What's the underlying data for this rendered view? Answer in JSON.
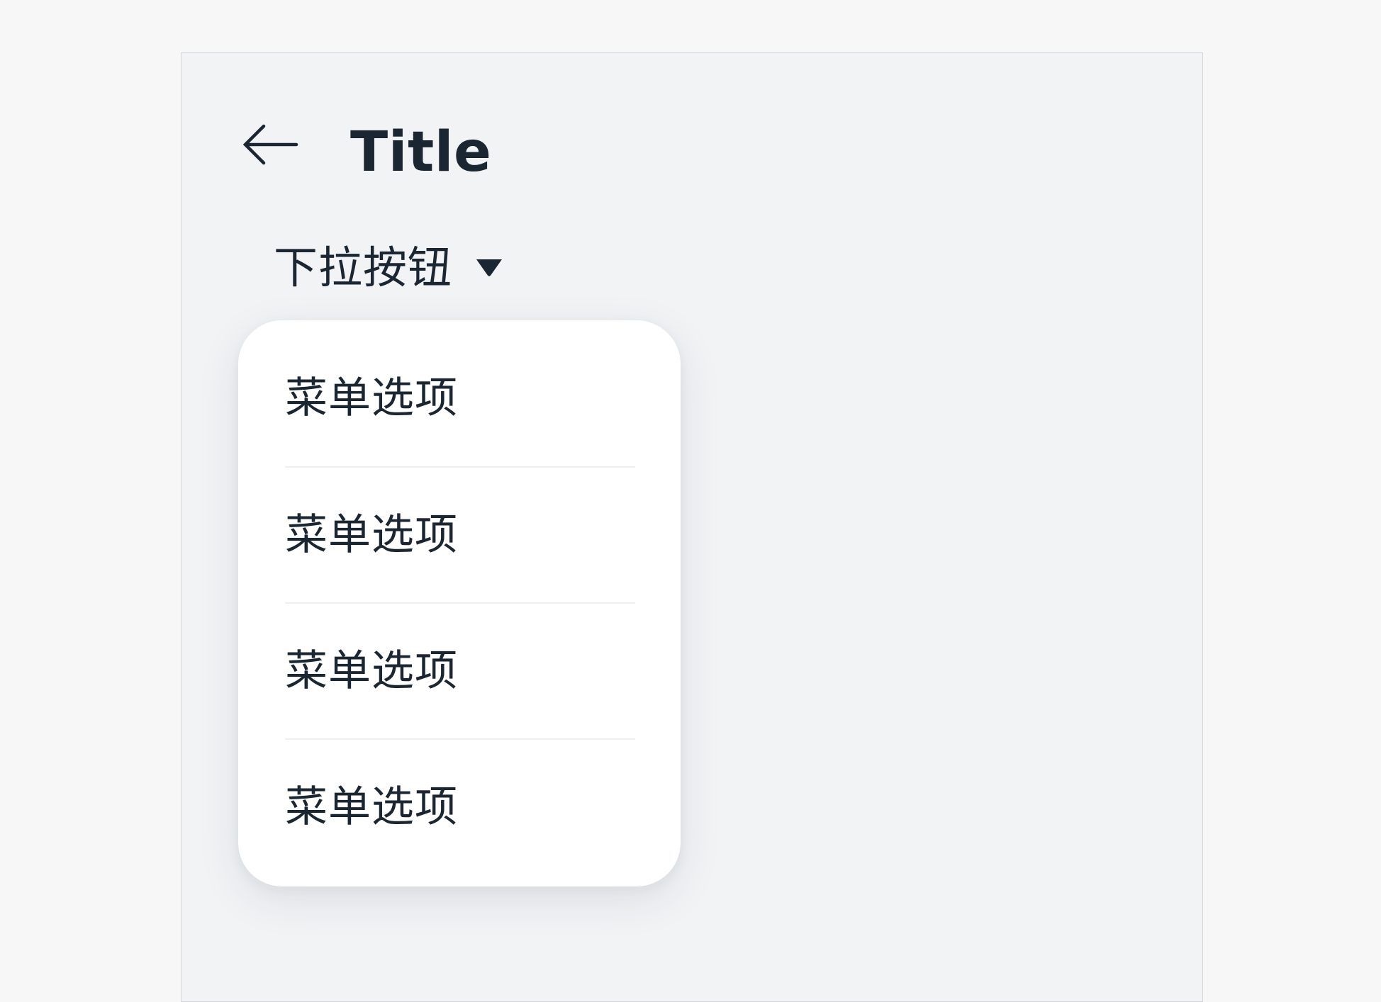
{
  "app_bar": {
    "back_icon": "arrow-left-icon",
    "title": "Title"
  },
  "dropdown": {
    "label": "下拉按钮",
    "caret_icon": "caret-down-icon",
    "expanded": true,
    "items": [
      {
        "label": "菜单选项"
      },
      {
        "label": "菜单选项"
      },
      {
        "label": "菜单选项"
      },
      {
        "label": "菜单选项"
      }
    ]
  },
  "colors": {
    "page_background": "#f7f7f7",
    "surface": "#f1f3f5",
    "menu_background": "#ffffff",
    "text_primary": "#1b2633",
    "divider": "#eeeff1"
  }
}
